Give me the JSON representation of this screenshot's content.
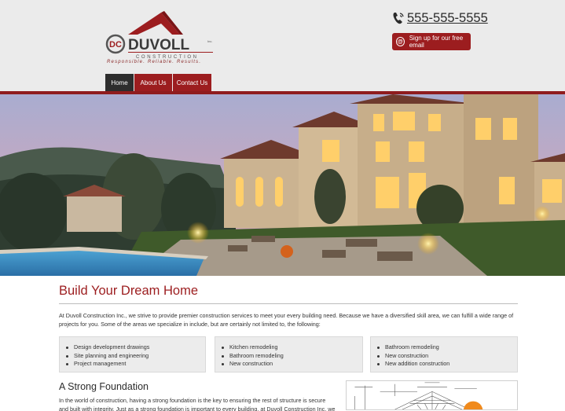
{
  "header": {
    "logo": {
      "brand": "DUVOLL",
      "sub": "CONSTRUCTION",
      "inc": "Inc.",
      "tagline": "Responsible. Reliable. Results."
    },
    "phone": "555-555-5555",
    "signup_label": "Sign up for our free email"
  },
  "nav": {
    "items": [
      "Home",
      "About Us",
      "Contact Us"
    ]
  },
  "main": {
    "title": "Build Your Dream Home",
    "intro": "At Duvoll Construction Inc., we strive to provide premier construction services to meet your every building need. Because we have a diversified skill area, we can fulfill a wide range of projects for you. Some of the areas we specialize in include, but are certainly not limited to, the following:",
    "services": [
      [
        "Design development drawings",
        "Site planning and engineering",
        "Project management"
      ],
      [
        "Kitchen remodeling",
        "Bathroom remodeling",
        "New construction"
      ],
      [
        "Bathroom remodeling",
        "New construction",
        "New addition construction"
      ]
    ],
    "section2_title": "A Strong Foundation",
    "section2_text": "In the world of construction, having a strong foundation is the key to ensuring the rest of structure is secure and built with integrity. Just as a strong foundation is important to every building, at Duvoll Construction Inc. we have"
  },
  "colors": {
    "accent": "#9c1d1f",
    "dark": "#2d2d2d",
    "header_bg": "#ebebeb"
  }
}
